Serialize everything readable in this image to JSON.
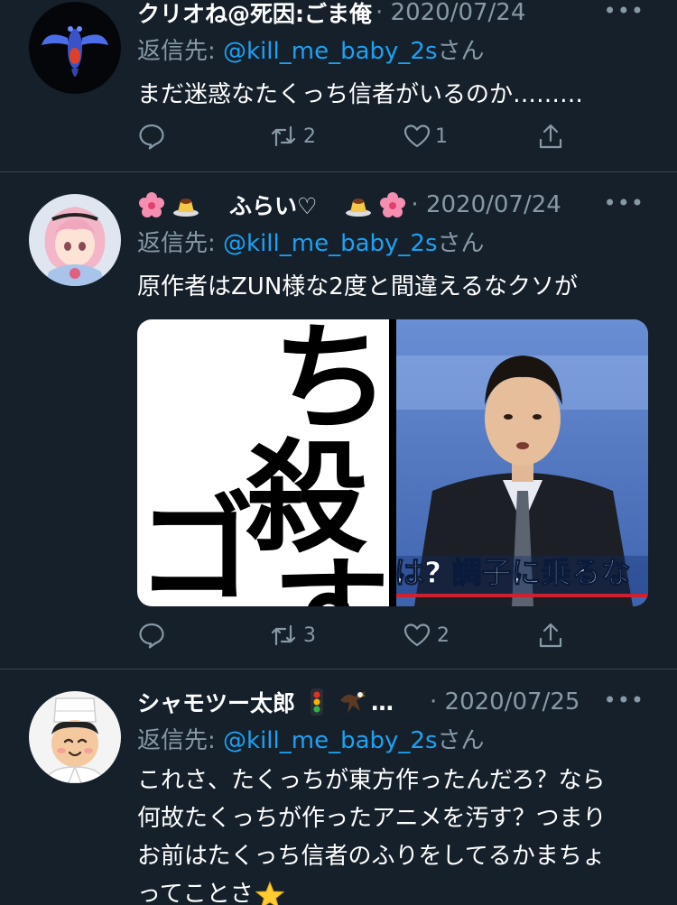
{
  "tweets": [
    {
      "name": "クリオね@死因:ごま俺",
      "time": "· 2020/07/24",
      "reply_prefix": "返信先: ",
      "reply_handle": "@kill_me_baby_2s",
      "reply_suffix": "さん",
      "text": "まだ迷惑なたくっち信者がいるのか………",
      "retweets": "2",
      "likes": "1",
      "avatar_icon": "sea-angel-avatar"
    },
    {
      "name": "ふらい♡",
      "time": "· 2020/07/24",
      "reply_prefix": "返信先: ",
      "reply_handle": "@kill_me_baby_2s",
      "reply_suffix": "さん",
      "text": "原作者はZUN様な2度と間違えるなクソが",
      "retweets": "3",
      "likes": "2",
      "avatar_icon": "anime-girl-avatar",
      "media": {
        "left_glyphs": [
          "ち",
          "殺",
          "ゴ",
          "す"
        ],
        "right_caption": "は? 調子に乗るな"
      }
    },
    {
      "name": "シャモツー太郎",
      "name_suffix": "…",
      "time": "· 2020/07/25",
      "reply_prefix": "返信先: ",
      "reply_handle": "@kill_me_baby_2s",
      "reply_suffix": "さん",
      "text_lines": [
        "これさ、たくっちが東方作ったんだろ？なら",
        "何故たくっちが作ったアニメを汚す？つまり",
        "お前はたくっち信者のふりをしてるかまちょ",
        "ってことさ"
      ],
      "avatar_icon": "chef-avatar"
    }
  ],
  "more_label": "•••",
  "colors": {
    "background": "#15202b",
    "secondary_text": "#8899a6",
    "link": "#1da1f2",
    "divider": "#38444d"
  }
}
